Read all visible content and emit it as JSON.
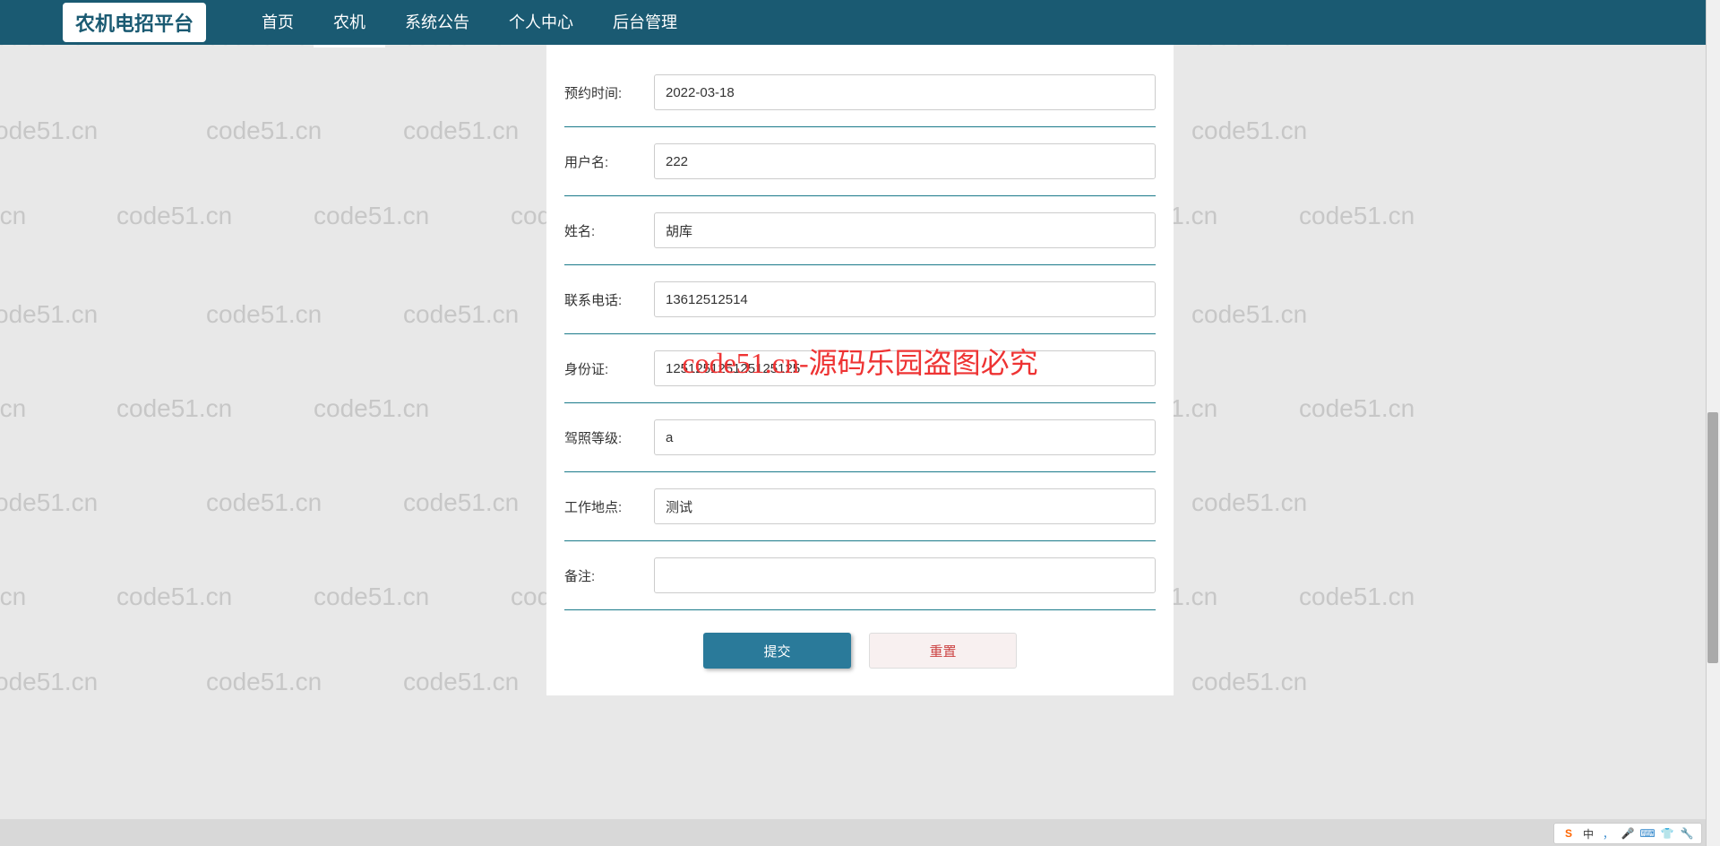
{
  "logo": "农机电招平台",
  "nav": {
    "items": [
      {
        "label": "首页"
      },
      {
        "label": "农机"
      },
      {
        "label": "系统公告"
      },
      {
        "label": "个人中心"
      },
      {
        "label": "后台管理"
      }
    ]
  },
  "form": {
    "fields": [
      {
        "label": "预约时间:",
        "value": "2022-03-18"
      },
      {
        "label": "用户名:",
        "value": "222"
      },
      {
        "label": "姓名:",
        "value": "胡库"
      },
      {
        "label": "联系电话:",
        "value": "13612512514"
      },
      {
        "label": "身份证:",
        "value": "125125125125125125"
      },
      {
        "label": "驾照等级:",
        "value": "a"
      },
      {
        "label": "工作地点:",
        "value": "测试"
      },
      {
        "label": "备注:",
        "value": ""
      }
    ],
    "buttons": {
      "submit": "提交",
      "reset": "重置"
    }
  },
  "overlay": "code51.cn-源码乐园盗图必究",
  "watermark": "code51.cn",
  "ime": {
    "logo": "S",
    "lang": "中"
  }
}
